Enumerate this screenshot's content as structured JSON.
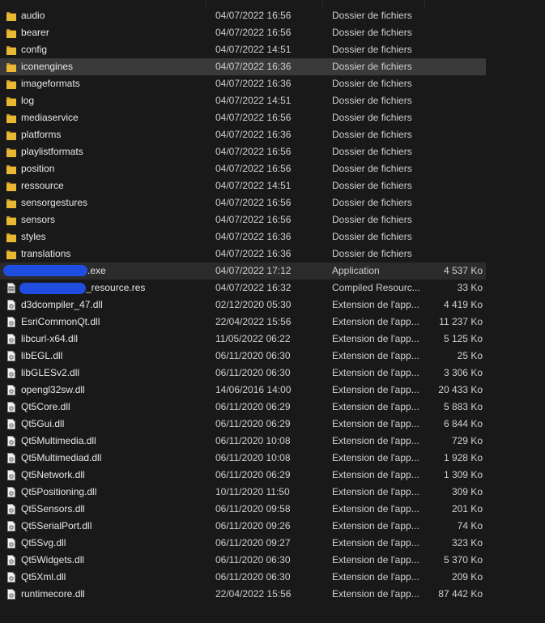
{
  "files": [
    {
      "name": "audio",
      "date": "04/07/2022 16:56",
      "type": "Dossier de fichiers",
      "size": "",
      "icon": "folder-icon"
    },
    {
      "name": "bearer",
      "date": "04/07/2022 16:56",
      "type": "Dossier de fichiers",
      "size": "",
      "icon": "folder-icon"
    },
    {
      "name": "config",
      "date": "04/07/2022 14:51",
      "type": "Dossier de fichiers",
      "size": "",
      "icon": "folder-icon"
    },
    {
      "name": "iconengines",
      "date": "04/07/2022 16:36",
      "type": "Dossier de fichiers",
      "size": "",
      "icon": "folder-icon",
      "state": "selected"
    },
    {
      "name": "imageformats",
      "date": "04/07/2022 16:36",
      "type": "Dossier de fichiers",
      "size": "",
      "icon": "folder-icon"
    },
    {
      "name": "log",
      "date": "04/07/2022 14:51",
      "type": "Dossier de fichiers",
      "size": "",
      "icon": "folder-icon"
    },
    {
      "name": "mediaservice",
      "date": "04/07/2022 16:56",
      "type": "Dossier de fichiers",
      "size": "",
      "icon": "folder-icon"
    },
    {
      "name": "platforms",
      "date": "04/07/2022 16:36",
      "type": "Dossier de fichiers",
      "size": "",
      "icon": "folder-icon"
    },
    {
      "name": "playlistformats",
      "date": "04/07/2022 16:56",
      "type": "Dossier de fichiers",
      "size": "",
      "icon": "folder-icon"
    },
    {
      "name": "position",
      "date": "04/07/2022 16:56",
      "type": "Dossier de fichiers",
      "size": "",
      "icon": "folder-icon"
    },
    {
      "name": "ressource",
      "date": "04/07/2022 14:51",
      "type": "Dossier de fichiers",
      "size": "",
      "icon": "folder-icon"
    },
    {
      "name": "sensorgestures",
      "date": "04/07/2022 16:56",
      "type": "Dossier de fichiers",
      "size": "",
      "icon": "folder-icon"
    },
    {
      "name": "sensors",
      "date": "04/07/2022 16:56",
      "type": "Dossier de fichiers",
      "size": "",
      "icon": "folder-icon"
    },
    {
      "name": "styles",
      "date": "04/07/2022 16:36",
      "type": "Dossier de fichiers",
      "size": "",
      "icon": "folder-icon"
    },
    {
      "name": "translations",
      "date": "04/07/2022 16:36",
      "type": "Dossier de fichiers",
      "size": "",
      "icon": "folder-icon"
    },
    {
      "name": ".exe",
      "date": "04/07/2022 17:12",
      "type": "Application",
      "size": "4 537 Ko",
      "icon": "application-icon",
      "state": "hovered",
      "redacted": true
    },
    {
      "name": "_resource.res",
      "date": "04/07/2022 16:32",
      "type": "Compiled Resourc...",
      "size": "33 Ko",
      "icon": "resource-file-icon",
      "redacted": true
    },
    {
      "name": "d3dcompiler_47.dll",
      "date": "02/12/2020 05:30",
      "type": "Extension de l'app...",
      "size": "4 419 Ko",
      "icon": "dll-file-icon"
    },
    {
      "name": "EsriCommonQt.dll",
      "date": "22/04/2022 15:56",
      "type": "Extension de l'app...",
      "size": "11 237 Ko",
      "icon": "dll-file-icon"
    },
    {
      "name": "libcurl-x64.dll",
      "date": "11/05/2022 06:22",
      "type": "Extension de l'app...",
      "size": "5 125 Ko",
      "icon": "dll-file-icon"
    },
    {
      "name": "libEGL.dll",
      "date": "06/11/2020 06:30",
      "type": "Extension de l'app...",
      "size": "25 Ko",
      "icon": "dll-file-icon"
    },
    {
      "name": "libGLESv2.dll",
      "date": "06/11/2020 06:30",
      "type": "Extension de l'app...",
      "size": "3 306 Ko",
      "icon": "dll-file-icon"
    },
    {
      "name": "opengl32sw.dll",
      "date": "14/06/2016 14:00",
      "type": "Extension de l'app...",
      "size": "20 433 Ko",
      "icon": "dll-file-icon"
    },
    {
      "name": "Qt5Core.dll",
      "date": "06/11/2020 06:29",
      "type": "Extension de l'app...",
      "size": "5 883 Ko",
      "icon": "dll-file-icon"
    },
    {
      "name": "Qt5Gui.dll",
      "date": "06/11/2020 06:29",
      "type": "Extension de l'app...",
      "size": "6 844 Ko",
      "icon": "dll-file-icon"
    },
    {
      "name": "Qt5Multimedia.dll",
      "date": "06/11/2020 10:08",
      "type": "Extension de l'app...",
      "size": "729 Ko",
      "icon": "dll-file-icon"
    },
    {
      "name": "Qt5Multimediad.dll",
      "date": "06/11/2020 10:08",
      "type": "Extension de l'app...",
      "size": "1 928 Ko",
      "icon": "dll-file-icon"
    },
    {
      "name": "Qt5Network.dll",
      "date": "06/11/2020 06:29",
      "type": "Extension de l'app...",
      "size": "1 309 Ko",
      "icon": "dll-file-icon"
    },
    {
      "name": "Qt5Positioning.dll",
      "date": "10/11/2020 11:50",
      "type": "Extension de l'app...",
      "size": "309 Ko",
      "icon": "dll-file-icon"
    },
    {
      "name": "Qt5Sensors.dll",
      "date": "06/11/2020 09:58",
      "type": "Extension de l'app...",
      "size": "201 Ko",
      "icon": "dll-file-icon"
    },
    {
      "name": "Qt5SerialPort.dll",
      "date": "06/11/2020 09:26",
      "type": "Extension de l'app...",
      "size": "74 Ko",
      "icon": "dll-file-icon"
    },
    {
      "name": "Qt5Svg.dll",
      "date": "06/11/2020 09:27",
      "type": "Extension de l'app...",
      "size": "323 Ko",
      "icon": "dll-file-icon"
    },
    {
      "name": "Qt5Widgets.dll",
      "date": "06/11/2020 06:30",
      "type": "Extension de l'app...",
      "size": "5 370 Ko",
      "icon": "dll-file-icon"
    },
    {
      "name": "Qt5Xml.dll",
      "date": "06/11/2020 06:30",
      "type": "Extension de l'app...",
      "size": "209 Ko",
      "icon": "dll-file-icon"
    },
    {
      "name": "runtimecore.dll",
      "date": "22/04/2022 15:56",
      "type": "Extension de l'app...",
      "size": "87 442 Ko",
      "icon": "dll-file-icon"
    }
  ],
  "colors": {
    "background": "#191919",
    "selected_row": "#3a3a3a",
    "hovered_row": "#2b2b2b",
    "folder": "#e8b833",
    "redaction": "#1f4de0"
  }
}
